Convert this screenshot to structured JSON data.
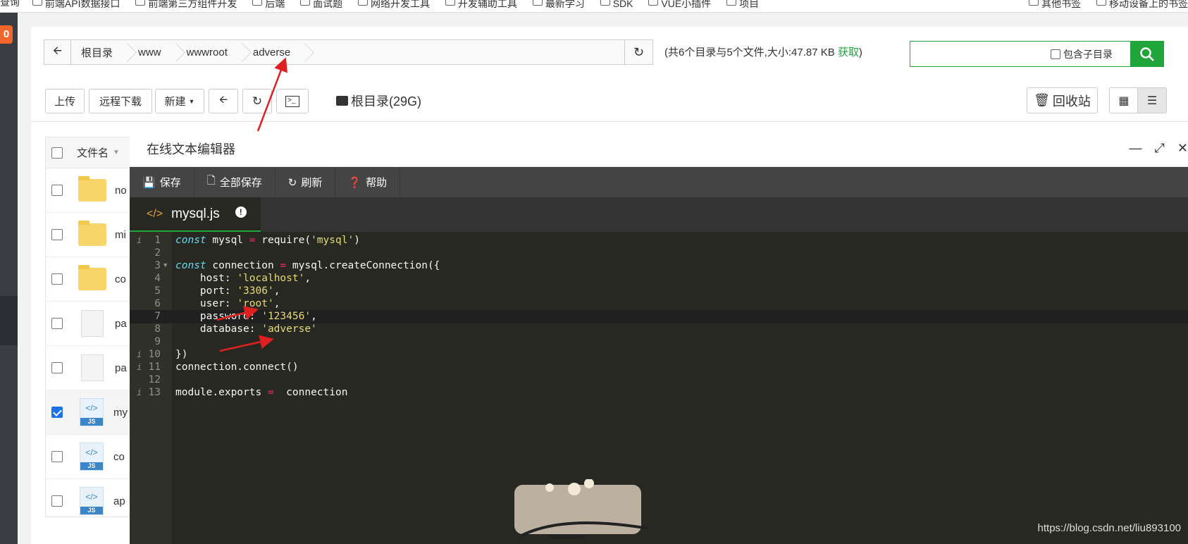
{
  "bookmarks": {
    "items": [
      "查询",
      "前端API数据接口",
      "前端第三方组件开发",
      "后端",
      "面试题",
      "网络开发工具",
      "开发辅助工具",
      "最新学习",
      "SDK",
      "VUE小插件",
      "项目"
    ],
    "right_items": [
      "其他书签",
      "移动设备上的书签"
    ]
  },
  "sidebar": {
    "badge": "0"
  },
  "breadcrumb": {
    "items": [
      "根目录",
      "www",
      "wwwroot",
      "adverse"
    ]
  },
  "dir_info": {
    "text": "(共6个目录与5个文件,大小:47.87 KB ",
    "link": "获取",
    "tail": ")"
  },
  "search": {
    "include_subdir": "包含子目录",
    "value": ""
  },
  "toolbar": {
    "upload": "上传",
    "remote_download": "远程下载",
    "new": "新建",
    "disk": "根目录(29G)",
    "recycle": "回收站"
  },
  "file_table": {
    "header": "文件名",
    "rows": [
      {
        "name": "no",
        "type": "folder",
        "checked": false
      },
      {
        "name": "mi",
        "type": "folder",
        "checked": false
      },
      {
        "name": "co",
        "type": "folder",
        "checked": false
      },
      {
        "name": "pa",
        "type": "file",
        "checked": false
      },
      {
        "name": "pa",
        "type": "file",
        "checked": false
      },
      {
        "name": "my",
        "type": "js",
        "checked": true
      },
      {
        "name": "co",
        "type": "js",
        "checked": false
      },
      {
        "name": "ap",
        "type": "js",
        "checked": false
      }
    ]
  },
  "editor": {
    "title": "在线文本编辑器",
    "buttons": {
      "save": "保存",
      "save_all": "全部保存",
      "refresh": "刷新",
      "help": "帮助"
    },
    "tab": "mysql.js",
    "lines": [
      "1",
      "2",
      "3",
      "4",
      "5",
      "6",
      "7",
      "8",
      "9",
      "10",
      "11",
      "12",
      "13"
    ]
  },
  "code": {
    "l1_kw": "const",
    "l1_a": " mysql ",
    "l1_op": "=",
    "l1_b": " require(",
    "l1_s": "'mysql'",
    "l1_c": ")",
    "l3_kw": "const",
    "l3_a": " connection ",
    "l3_op": "=",
    "l3_b": " mysql.createConnection({",
    "l4_a": "    host: ",
    "l4_s": "'localhost'",
    "l5_a": "    port: ",
    "l5_s": "'3306'",
    "l6_a": "    user: ",
    "l6_s": "'root'",
    "l7_a": "    password: ",
    "l7_s": "'123456'",
    "l8_a": "    database: ",
    "l8_s": "'adverse'",
    "l10": "})",
    "l11": "connection.connect()",
    "l13_a": "module.exports ",
    "l13_op": "=",
    "l13_b": "  connection",
    "comma": ","
  },
  "watermark": "https://blog.csdn.net/liu893100",
  "colors": {
    "accent": "#20a53a",
    "editor_bg": "#272822",
    "arrow": "#e02020"
  }
}
